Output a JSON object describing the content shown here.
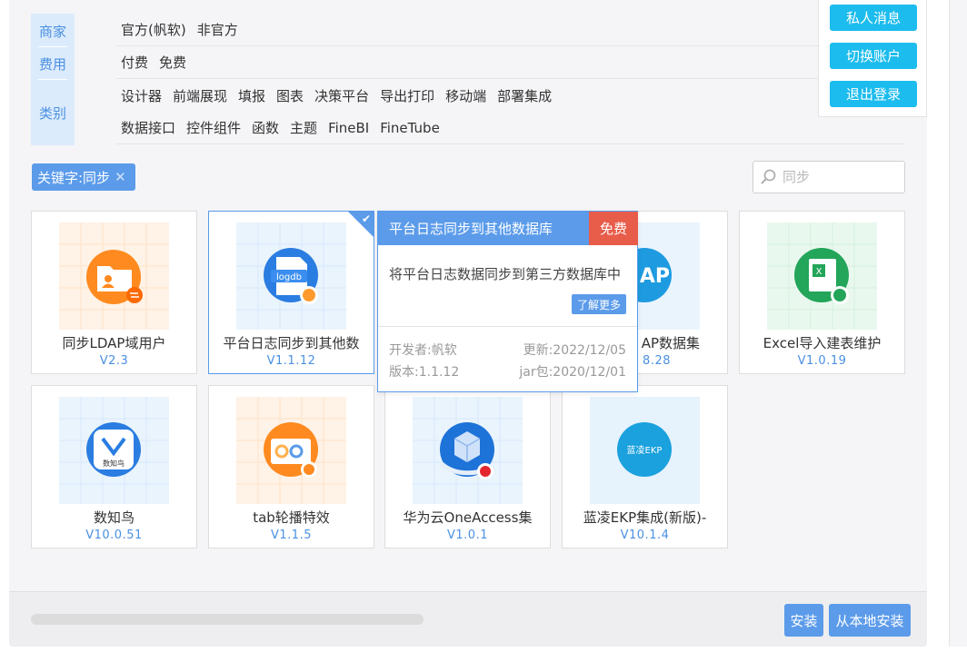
{
  "filters": {
    "labels": {
      "vendor": "商家",
      "fee": "费用",
      "category": "类别"
    },
    "vendor_options": [
      "官方(帆软)",
      "非官方"
    ],
    "fee_options": [
      "付费",
      "免费"
    ],
    "category_row1": [
      "设计器",
      "前端展现",
      "填报",
      "图表",
      "决策平台",
      "导出打印",
      "移动端",
      "部署集成"
    ],
    "category_row2": [
      "数据接口",
      "控件组件",
      "函数",
      "主题",
      "FineBI",
      "FineTube"
    ]
  },
  "user_menu": {
    "messages": "私人消息",
    "switch": "切换账户",
    "logout": "退出登录"
  },
  "keyword_tag": {
    "label": "关键字:同步",
    "close": "✕"
  },
  "search": {
    "placeholder": "同步"
  },
  "plugins": [
    {
      "name": "同步LDAP域用户",
      "version": "V2.3"
    },
    {
      "name": "平台日志同步到其他数",
      "version": "V1.1.12"
    },
    {
      "name": "AP数据集",
      "version": "8.28"
    },
    {
      "name": "Excel导入建表维护",
      "version": "V1.0.19"
    },
    {
      "name": "数知鸟",
      "version": "V10.0.51"
    },
    {
      "name": "tab轮播特效",
      "version": "V1.1.5"
    },
    {
      "name": "华为云OneAccess集",
      "version": "V1.0.1"
    },
    {
      "name": "蓝凌EKP集成(新版)-",
      "version": "V10.1.4"
    }
  ],
  "icon_text": {
    "logdb": "logdb",
    "ldap": "AP",
    "excel": "X",
    "shuzhiniao": "数知鸟",
    "ekp": "蓝凌EKP"
  },
  "popup": {
    "title": "平台日志同步到其他数据库",
    "badge": "免费",
    "description": "将平台日志数据同步到第三方数据库中",
    "more": "了解更多",
    "developer": "开发者:帆软",
    "updated": "更新:2022/12/05",
    "version": "版本:1.1.12",
    "jar": "jar包:2020/12/01"
  },
  "actions": {
    "install": "安装",
    "install_local": "从本地安装"
  },
  "colors": {
    "accent": "#5b9bea",
    "cyan": "#1cbcee",
    "badge_red": "#e85c4a",
    "link_blue": "#4a90e2"
  }
}
